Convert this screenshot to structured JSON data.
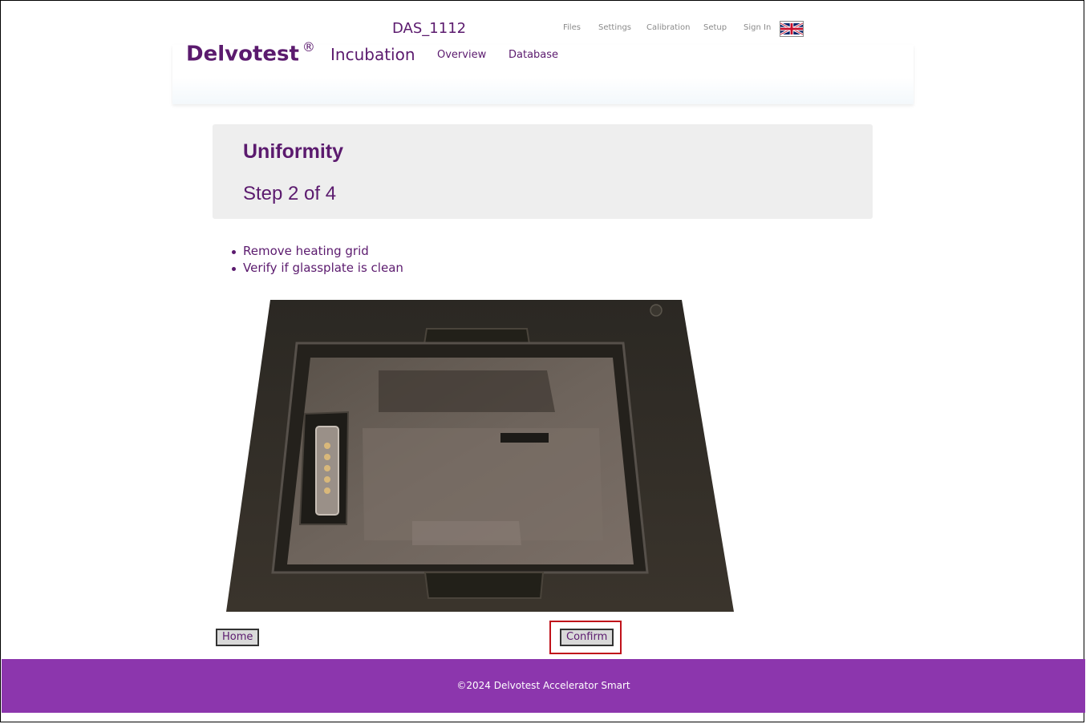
{
  "header": {
    "device_name": "DAS_1112",
    "top_links": [
      "Files",
      "Settings",
      "Calibration",
      "Setup",
      "Sign In"
    ],
    "flag_icon": "uk-flag-icon",
    "brand": "Delvotest",
    "brand_mark": "®",
    "nav": {
      "main": "Incubation",
      "overview": "Overview",
      "database": "Database"
    }
  },
  "panel": {
    "title": "Uniformity",
    "step": "Step 2 of 4"
  },
  "instructions": [
    "Remove heating grid",
    "Verify if glassplate is clean"
  ],
  "buttons": {
    "home": "Home",
    "confirm": "Confirm"
  },
  "footer": {
    "text": "©2024 Delvotest Accelerator Smart"
  },
  "colors": {
    "brand": "#5b1a6e",
    "footer": "#8c36ad",
    "highlight": "#c0121b"
  }
}
